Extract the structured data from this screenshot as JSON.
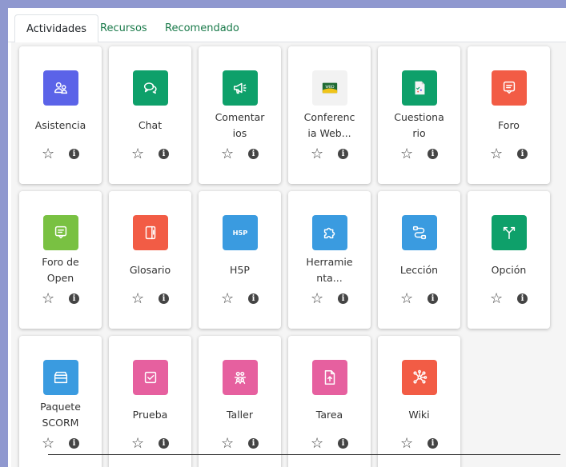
{
  "tabs": {
    "activities": "Actividades",
    "resources": "Recursos",
    "recommended": "Recomendado"
  },
  "colors": {
    "purple": "#5b63e8",
    "green": "#0ea06a",
    "red": "#f25c45",
    "lime": "#79c142",
    "blue": "#3a9be0",
    "pink": "#e6609f",
    "tab_link": "#1a7a4a"
  },
  "modules": [
    {
      "label": "Asistencia",
      "icon": "attendance-icon",
      "color": "#5b63e8"
    },
    {
      "label": "Chat",
      "icon": "chat-icon",
      "color": "#0ea06a"
    },
    {
      "label": "Comentar\nios",
      "icon": "megaphone-icon",
      "color": "#0ea06a"
    },
    {
      "label": "Conferenc\nia Web...",
      "icon": "webconference-logo-icon",
      "color": "#f2f2f2"
    },
    {
      "label": "Cuestiona\nrio",
      "icon": "questionnaire-icon",
      "color": "#0ea06a"
    },
    {
      "label": "Foro",
      "icon": "forum-icon",
      "color": "#f25c45"
    },
    {
      "label": "Foro de\nOpen",
      "icon": "open-forum-icon",
      "color": "#79c142"
    },
    {
      "label": "Glosario",
      "icon": "glossary-icon",
      "color": "#f25c45"
    },
    {
      "label": "H5P",
      "icon": "h5p-icon",
      "color": "#3a9be0"
    },
    {
      "label": "Herramie\nnta...",
      "icon": "puzzle-icon",
      "color": "#3a9be0"
    },
    {
      "label": "Lección",
      "icon": "lesson-icon",
      "color": "#3a9be0"
    },
    {
      "label": "Opción",
      "icon": "choice-icon",
      "color": "#0ea06a"
    },
    {
      "label": "Paquete\nSCORM",
      "icon": "scorm-package-icon",
      "color": "#3a9be0"
    },
    {
      "label": "Prueba",
      "icon": "quiz-icon",
      "color": "#e6609f"
    },
    {
      "label": "Taller",
      "icon": "workshop-icon",
      "color": "#e6609f"
    },
    {
      "label": "Tarea",
      "icon": "assignment-icon",
      "color": "#e6609f"
    },
    {
      "label": "Wiki",
      "icon": "wiki-icon",
      "color": "#f25c45"
    }
  ]
}
